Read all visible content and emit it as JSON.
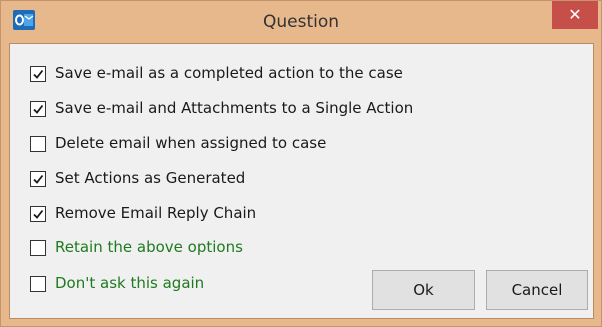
{
  "window": {
    "title": "Question",
    "app_icon": "outlook-icon",
    "close_label": "✕"
  },
  "options": [
    {
      "label": "Save e-mail as a completed action to the case",
      "checked": true,
      "color": "#1a1a1a"
    },
    {
      "label": "Save e-mail and Attachments to a Single Action",
      "checked": true,
      "color": "#1a1a1a"
    },
    {
      "label": "Delete email when assigned to case",
      "checked": false,
      "color": "#1a1a1a"
    },
    {
      "label": "Set Actions as Generated",
      "checked": true,
      "color": "#1a1a1a"
    },
    {
      "label": "Remove Email Reply Chain",
      "checked": true,
      "color": "#1a1a1a"
    },
    {
      "label": "Retain the above options",
      "checked": false,
      "color": "#1f7a1f"
    },
    {
      "label": "Don't ask this again",
      "checked": false,
      "color": "#1f7a1f"
    }
  ],
  "buttons": {
    "ok": "Ok",
    "cancel": "Cancel"
  },
  "colors": {
    "frame": "#e6b88b",
    "close": "#c74f4a",
    "accent_text": "#1f7a1f"
  }
}
